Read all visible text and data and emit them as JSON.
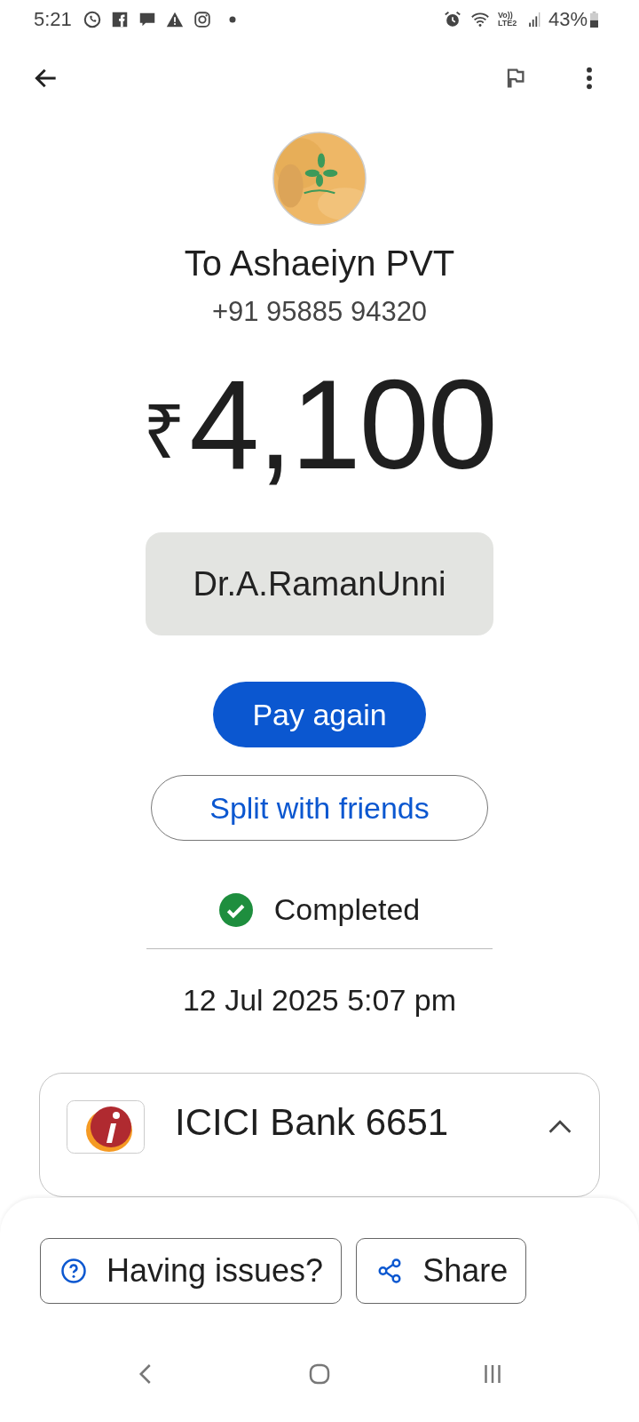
{
  "status_bar": {
    "time": "5:21",
    "network": "Vo))\nLTE2",
    "battery": "43%"
  },
  "recipient": {
    "name": "To Ashaeiyn PVT",
    "phone": "+91 95885 94320"
  },
  "amount": {
    "currency": "₹",
    "value": "4,100"
  },
  "note": "Dr.A.RamanUnni",
  "buttons": [
    {
      "label": "Pay again",
      "kind": "filled"
    },
    {
      "label": "Split with friends",
      "kind": "outlined"
    }
  ],
  "status": {
    "label": "Completed",
    "completed": true
  },
  "datetime": "12 Jul 2025 5:07 pm",
  "account": {
    "name": "ICICI Bank 6651",
    "expanded": true
  },
  "actions": [
    {
      "label": "Having issues?",
      "kind": "help"
    },
    {
      "label": "Share",
      "kind": "share"
    }
  ]
}
